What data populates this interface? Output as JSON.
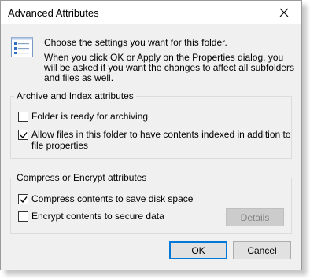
{
  "window": {
    "title": "Advanced Attributes"
  },
  "intro": {
    "line1": "Choose the settings you want for this folder.",
    "line2": "When you click OK or Apply on the Properties dialog, you will be asked if you want the changes to affect all subfolders and files as well."
  },
  "archive_group": {
    "label": "Archive and Index attributes",
    "options": [
      {
        "label": "Folder is ready for archiving",
        "checked": false
      },
      {
        "label": "Allow files in this folder to have contents indexed in addition to file properties",
        "checked": true
      }
    ]
  },
  "compress_group": {
    "label": "Compress or Encrypt attributes",
    "options": [
      {
        "label": "Compress contents to save disk space",
        "checked": true
      },
      {
        "label": "Encrypt contents to secure data",
        "checked": false
      }
    ],
    "details_label": "Details"
  },
  "buttons": {
    "ok": "OK",
    "cancel": "Cancel"
  },
  "icons": {
    "close": "close-icon",
    "settings_doc": "settings-document-icon",
    "check": "checkmark-icon"
  },
  "colors": {
    "accent": "#0078d7",
    "dialog_bg": "#f0f0f0"
  }
}
